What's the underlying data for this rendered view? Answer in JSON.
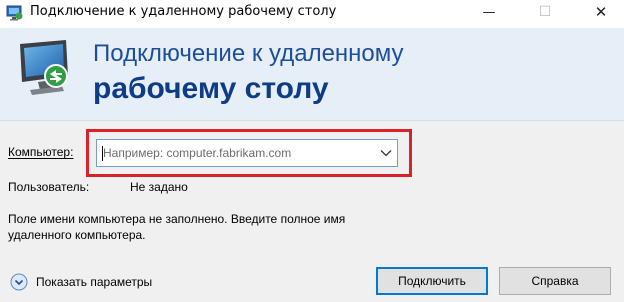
{
  "window": {
    "title": "Подключение к удаленному рабочему столу",
    "minimize_glyph": "—",
    "maximize_glyph": "☐",
    "close_glyph": "✕"
  },
  "banner": {
    "line1": "Подключение к удаленному",
    "line2": "рабочему столу"
  },
  "form": {
    "computer_label": "Компьютер:",
    "computer_placeholder": "Например: computer.fabrikam.com",
    "computer_value": "",
    "user_label": "Пользователь:",
    "user_value": "Не задано",
    "info_text": "Поле имени компьютера не заполнено. Введите полное имя удаленного компьютера."
  },
  "footer": {
    "show_options_label": "Показать параметры",
    "connect_label": "Подключить",
    "help_label": "Справка"
  },
  "colors": {
    "highlight": "#d8232a",
    "banner_bg": "#e6eef7",
    "banner_text": "#0f3c86",
    "accent": "#0078d7"
  },
  "icons": [
    "remote-desktop-app-icon",
    "remote-desktop-monitor-icon",
    "chevron-down-icon",
    "expand-options-icon"
  ]
}
